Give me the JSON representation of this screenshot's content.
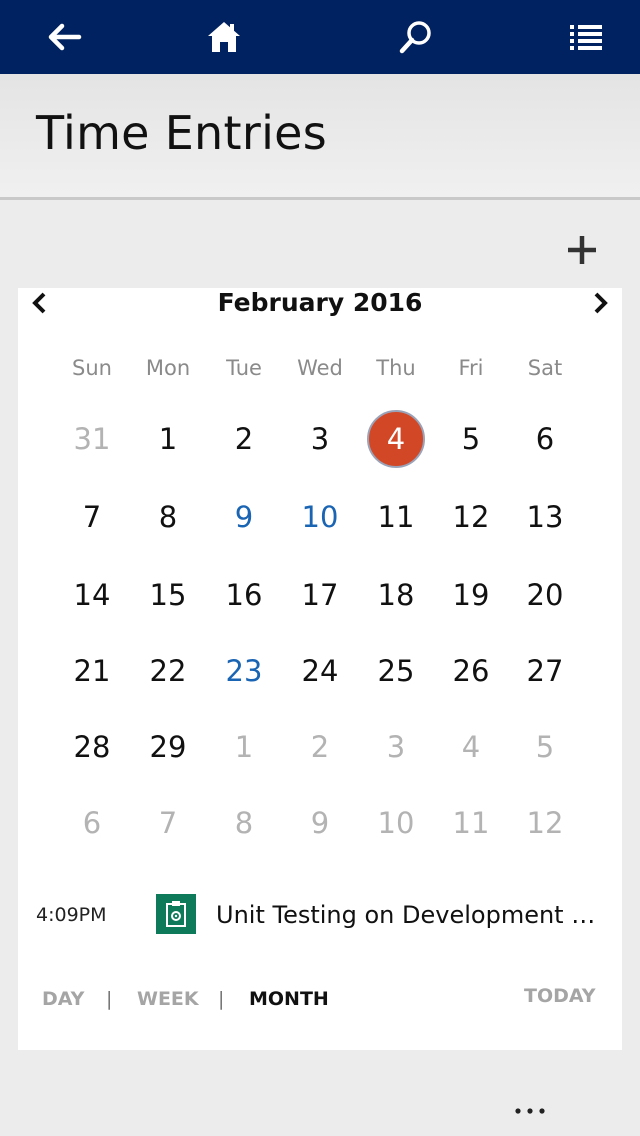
{
  "page": {
    "title": "Time Entries"
  },
  "topbar": {
    "icons": [
      "back-icon",
      "home-icon",
      "search-icon",
      "list-icon"
    ],
    "color": "#012260"
  },
  "calendar": {
    "month_label": "February 2016",
    "weekdays": [
      "Sun",
      "Mon",
      "Tue",
      "Wed",
      "Thu",
      "Fri",
      "Sat"
    ],
    "weeks": [
      [
        {
          "d": "31",
          "s": "muted"
        },
        {
          "d": "1",
          "s": ""
        },
        {
          "d": "2",
          "s": ""
        },
        {
          "d": "3",
          "s": ""
        },
        {
          "d": "4",
          "s": "selected"
        },
        {
          "d": "5",
          "s": ""
        },
        {
          "d": "6",
          "s": ""
        }
      ],
      [
        {
          "d": "7",
          "s": ""
        },
        {
          "d": "8",
          "s": ""
        },
        {
          "d": "9",
          "s": "blue"
        },
        {
          "d": "10",
          "s": "blue"
        },
        {
          "d": "11",
          "s": ""
        },
        {
          "d": "12",
          "s": ""
        },
        {
          "d": "13",
          "s": ""
        }
      ],
      [
        {
          "d": "14",
          "s": ""
        },
        {
          "d": "15",
          "s": ""
        },
        {
          "d": "16",
          "s": ""
        },
        {
          "d": "17",
          "s": ""
        },
        {
          "d": "18",
          "s": ""
        },
        {
          "d": "19",
          "s": ""
        },
        {
          "d": "20",
          "s": ""
        }
      ],
      [
        {
          "d": "21",
          "s": ""
        },
        {
          "d": "22",
          "s": ""
        },
        {
          "d": "23",
          "s": "blue"
        },
        {
          "d": "24",
          "s": ""
        },
        {
          "d": "25",
          "s": ""
        },
        {
          "d": "26",
          "s": ""
        },
        {
          "d": "27",
          "s": ""
        }
      ],
      [
        {
          "d": "28",
          "s": ""
        },
        {
          "d": "29",
          "s": ""
        },
        {
          "d": "1",
          "s": "muted"
        },
        {
          "d": "2",
          "s": "muted"
        },
        {
          "d": "3",
          "s": "muted"
        },
        {
          "d": "4",
          "s": "muted"
        },
        {
          "d": "5",
          "s": "muted"
        }
      ],
      [
        {
          "d": "6",
          "s": "muted"
        },
        {
          "d": "7",
          "s": "muted"
        },
        {
          "d": "8",
          "s": "muted"
        },
        {
          "d": "9",
          "s": "muted"
        },
        {
          "d": "10",
          "s": "muted"
        },
        {
          "d": "11",
          "s": "muted"
        },
        {
          "d": "12",
          "s": "muted"
        }
      ]
    ],
    "selected_color": "#d24726",
    "highlight_color": "#1a64b4"
  },
  "entries": [
    {
      "time": "4:09PM",
      "icon": "task-icon",
      "description": "Unit Testing on Development En…",
      "icon_color": "#0f7a5a"
    }
  ],
  "view_switcher": {
    "day": "DAY",
    "week": "WEEK",
    "month": "MONTH",
    "separator": "|",
    "active": "MONTH"
  },
  "today_label": "TODAY",
  "more_label": "…"
}
